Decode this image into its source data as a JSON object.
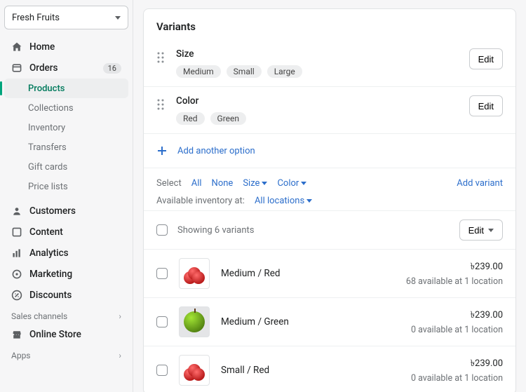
{
  "store": {
    "name": "Fresh Fruits"
  },
  "nav": {
    "home": "Home",
    "orders": "Orders",
    "orders_count": "16",
    "products": "Products",
    "collections": "Collections",
    "inventory": "Inventory",
    "transfers": "Transfers",
    "giftcards": "Gift cards",
    "pricelists": "Price lists",
    "customers": "Customers",
    "content": "Content",
    "analytics": "Analytics",
    "marketing": "Marketing",
    "discounts": "Discounts",
    "sales_channels": "Sales channels",
    "online_store": "Online Store",
    "apps": "Apps"
  },
  "variants": {
    "title": "Variants",
    "edit": "Edit",
    "options": [
      {
        "name": "Size",
        "values": [
          "Medium",
          "Small",
          "Large"
        ]
      },
      {
        "name": "Color",
        "values": [
          "Red",
          "Green"
        ]
      }
    ],
    "add_option": "Add another option",
    "select_label": "Select",
    "all": "All",
    "none": "None",
    "size_filter": "Size",
    "color_filter": "Color",
    "add_variant": "Add variant",
    "inventory_label": "Available inventory at:",
    "locations": "All locations",
    "showing": "Showing 6 variants",
    "rows": [
      {
        "title": "Medium / Red",
        "price": "৳239.00",
        "stock": "68 available at 1 location",
        "img": "red"
      },
      {
        "title": "Medium / Green",
        "price": "৳239.00",
        "stock": "0 available at 1 location",
        "img": "green"
      },
      {
        "title": "Small / Red",
        "price": "৳239.00",
        "stock": "0 available at 1 location",
        "img": "red"
      }
    ]
  }
}
